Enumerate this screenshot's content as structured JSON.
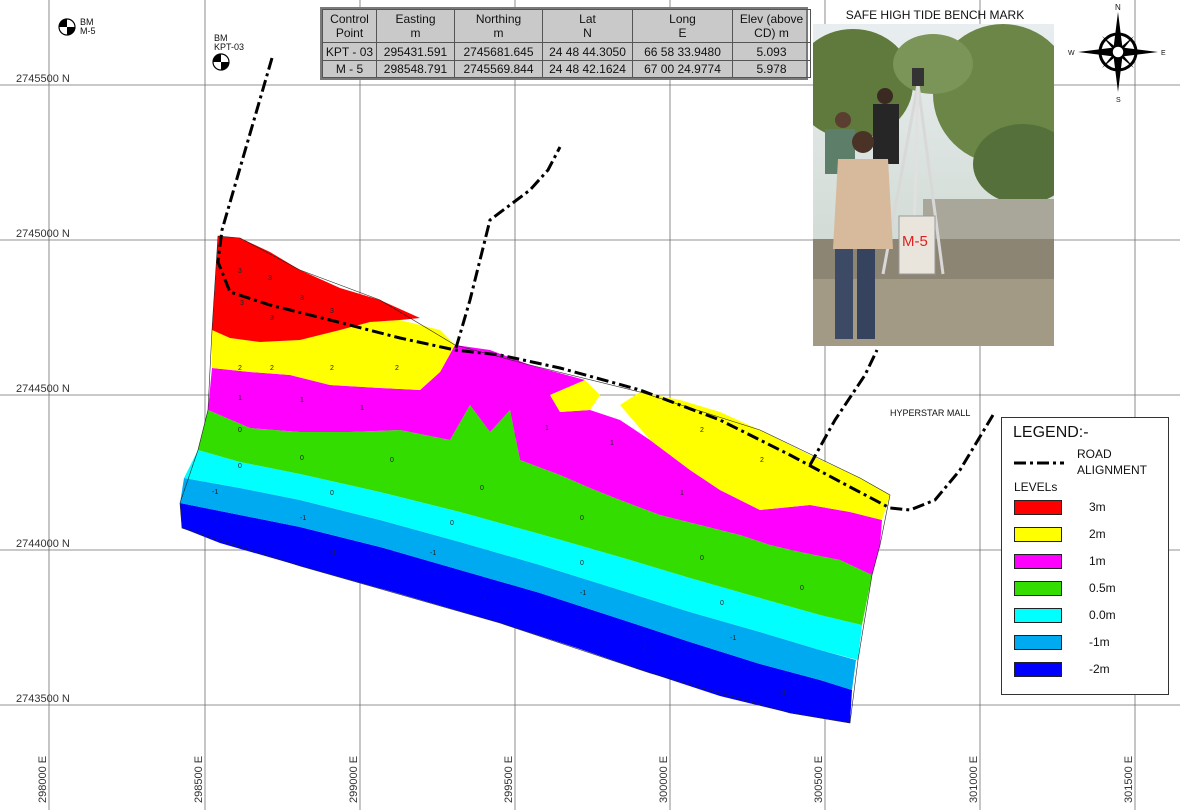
{
  "grid": {
    "northings": [
      "2745500 N",
      "2745000 N",
      "2744500 N",
      "2744000 N",
      "2743500 N"
    ],
    "eastings": [
      "298000 E",
      "298500 E",
      "299000 E",
      "299500 E",
      "300000 E",
      "300500 E",
      "301000 E",
      "301500 E"
    ]
  },
  "benchmarks": [
    {
      "name": "BM\nM-5",
      "line1": "BM",
      "line2": "M-5"
    },
    {
      "name": "BM\nKPT-03",
      "line1": "BM",
      "line2": "KPT-03"
    }
  ],
  "control_table": {
    "headers": [
      {
        "l1": "Control",
        "l2": "Point"
      },
      {
        "l1": "Easting",
        "l2": "m"
      },
      {
        "l1": "Northing",
        "l2": "m"
      },
      {
        "l1": "Lat",
        "l2": "N"
      },
      {
        "l1": "Long",
        "l2": "E"
      },
      {
        "l1": "Elev (above",
        "l2": "CD) m"
      }
    ],
    "rows": [
      [
        "KPT - 03",
        "295431.591",
        "2745681.645",
        "24 48 44.3050",
        "66 58 33.9480",
        "5.093"
      ],
      [
        "M - 5",
        "298548.791",
        "2745569.844",
        "24 48 42.1624",
        "67 00 24.9774",
        "5.978"
      ]
    ]
  },
  "photo": {
    "title": "SAFE HIGH TIDE BENCH MARK",
    "marker_text": "M-5"
  },
  "compass": {
    "n": "N",
    "s": "S",
    "e": "E",
    "w": "W"
  },
  "place_label": "HYPERSTAR MALL",
  "legend": {
    "title": "LEGEND:-",
    "road_label_l1": "ROAD",
    "road_label_l2": "ALIGNMENT",
    "levels_label": "LEVELs",
    "items": [
      {
        "label": "3m",
        "color": "#ff0000"
      },
      {
        "label": "2m",
        "color": "#ffff00"
      },
      {
        "label": "1m",
        "color": "#ff00ff"
      },
      {
        "label": "0.5m",
        "color": "#33dd00"
      },
      {
        "label": "0.0m",
        "color": "#00ffff"
      },
      {
        "label": "-1m",
        "color": "#00aaf0"
      },
      {
        "label": "-2m",
        "color": "#0000ff"
      }
    ]
  },
  "spot_levels": {
    "band_3m": "3",
    "band_2m": "2",
    "band_1m": "1",
    "band_05m": "0",
    "band_0m": "0",
    "band_m1": "-1",
    "band_m2": "-2"
  }
}
